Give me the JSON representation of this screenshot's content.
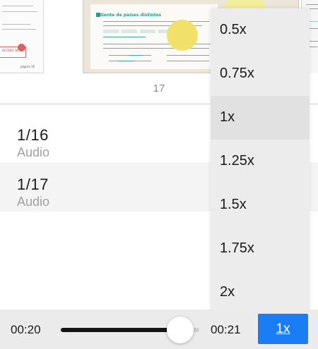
{
  "thumbnails": {
    "current_page_number": "17",
    "left_page": {
      "badge": "ACCESO 16",
      "page_label": "página 16"
    },
    "main_page": {
      "section_title": "Gente de países distintos"
    }
  },
  "tracks": [
    {
      "title": "1/16",
      "subtitle": "Audio"
    },
    {
      "title": "1/17",
      "subtitle": "Audio"
    }
  ],
  "speed_menu": {
    "options": [
      "0.5x",
      "0.75x",
      "1x",
      "1.25x",
      "1.5x",
      "1.75x",
      "2x"
    ],
    "selected": "1x"
  },
  "player": {
    "current_time": "00:20",
    "total_time": "00:21",
    "progress_fraction": 0.95,
    "speed_label": "1x"
  },
  "colors": {
    "accent": "#1a7df5",
    "textbook_teal": "#1e9f8e",
    "textbook_yellow": "#f1e06a"
  }
}
